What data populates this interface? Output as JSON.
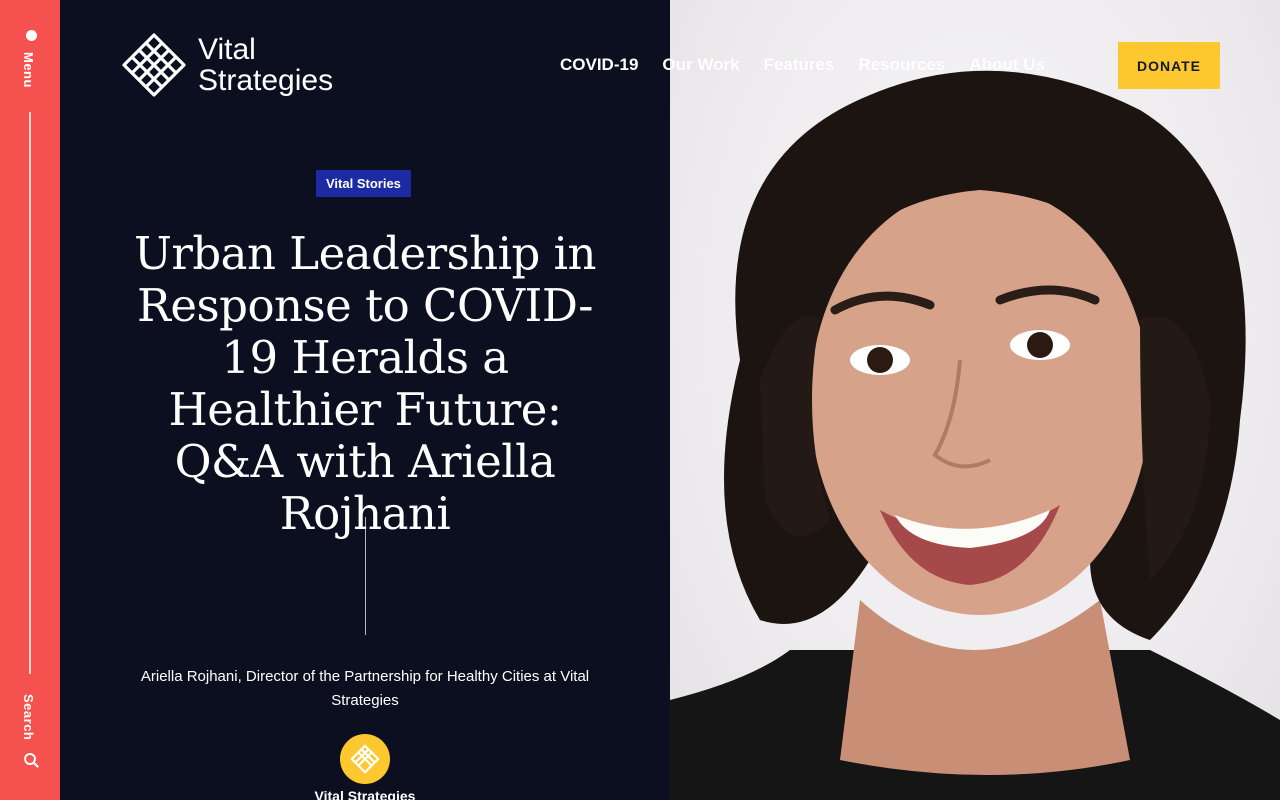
{
  "rail": {
    "menu_label": "Menu",
    "search_label": "Search"
  },
  "logo": {
    "line1": "Vital",
    "line2": "Strategies"
  },
  "nav": {
    "items": [
      "COVID-19",
      "Our Work",
      "Features",
      "Resources",
      "About Us"
    ],
    "donate": "DONATE"
  },
  "article": {
    "category": "Vital Stories",
    "title": "Urban Leadership in Response to COVID-19 Heralds a Healthier Future: Q&A with Ariella Rojhani",
    "caption": "Ariella Rojhani, Director of the Partnership for Healthy Cities at Vital Strategies",
    "author_badge": "Vital Strategies"
  },
  "colors": {
    "rail": "#f5514e",
    "panel": "#0b0f1f",
    "accent_yellow": "#fcc72f",
    "tag_blue": "#1c2aa3"
  }
}
